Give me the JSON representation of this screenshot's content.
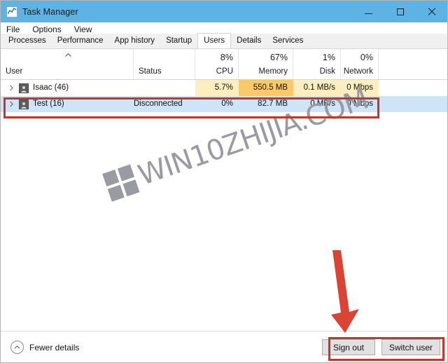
{
  "window": {
    "title": "Task Manager",
    "icon": "chart-icon",
    "controls": {
      "minimize": "minimize-icon",
      "maximize": "maximize-icon",
      "close": "close-icon"
    },
    "titlebar_color": "#5cb3e4"
  },
  "menubar": {
    "items": [
      "File",
      "Options",
      "View"
    ]
  },
  "tabs": [
    {
      "label": "Processes",
      "active": false
    },
    {
      "label": "Performance",
      "active": false
    },
    {
      "label": "App history",
      "active": false
    },
    {
      "label": "Startup",
      "active": false
    },
    {
      "label": "Users",
      "active": true
    },
    {
      "label": "Details",
      "active": false
    },
    {
      "label": "Services",
      "active": false
    }
  ],
  "table": {
    "sort": {
      "column": "User",
      "direction": "ascending",
      "icon": "chevron-up-icon"
    },
    "columns": [
      {
        "key": "user",
        "label": "User",
        "pct": "",
        "align": "left"
      },
      {
        "key": "status",
        "label": "Status",
        "pct": "",
        "align": "left"
      },
      {
        "key": "cpu",
        "label": "CPU",
        "pct": "8%",
        "align": "right"
      },
      {
        "key": "memory",
        "label": "Memory",
        "pct": "67%",
        "align": "right"
      },
      {
        "key": "disk",
        "label": "Disk",
        "pct": "1%",
        "align": "right"
      },
      {
        "key": "network",
        "label": "Network",
        "pct": "0%",
        "align": "right"
      }
    ],
    "rows": [
      {
        "expander": "chevron-right-icon",
        "badge": "user-account-icon",
        "user": "Isaac (46)",
        "status": "",
        "cpu": "5.7%",
        "memory": "550.5 MB",
        "disk": "0.1 MB/s",
        "network": "0 Mbps",
        "selected": false,
        "heat": {
          "cpu": "#fdeec0",
          "memory": "#f9c96b",
          "disk": "#fdeec0",
          "network": "#fdeec0"
        }
      },
      {
        "expander": "chevron-right-icon",
        "badge": "user-account-icon",
        "user": "Test (16)",
        "status": "Disconnected",
        "cpu": "0%",
        "memory": "82.7 MB",
        "disk": "0 MB/s",
        "network": "0 Mbps",
        "selected": true,
        "heat": {
          "cpu": "",
          "memory": "",
          "disk": "",
          "network": ""
        }
      }
    ]
  },
  "footer": {
    "fewer_details": "Fewer details",
    "fewer_details_icon": "chevron-up-circle-icon",
    "sign_out": "Sign out",
    "switch_user": "Switch user"
  },
  "annotations": {
    "highlight_color": "#c0392b",
    "arrow": "down-arrow-annotation",
    "row_box": "selected-user-row-highlight",
    "buttons_box": "action-buttons-highlight"
  },
  "watermark": {
    "text": "WIN10ZHIJIA.COM",
    "logo": "windows-logo-icon",
    "color": "#9a9aa2"
  }
}
